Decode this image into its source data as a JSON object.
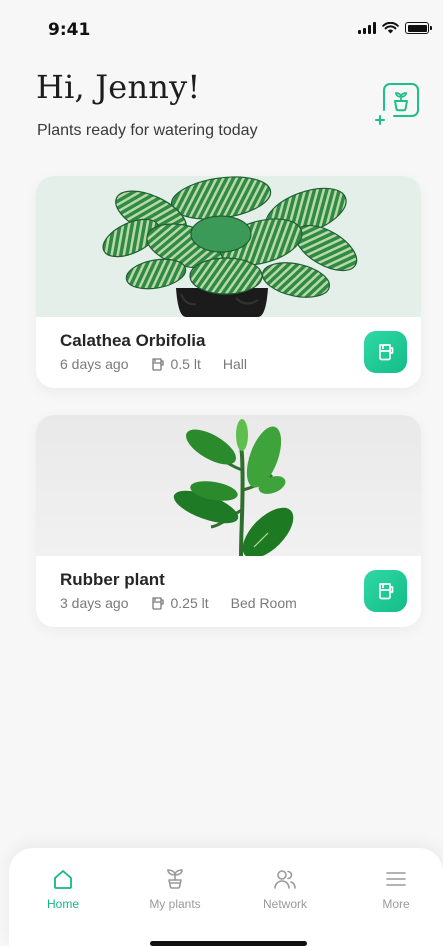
{
  "status_bar": {
    "time": "9:41",
    "icons": [
      "signal-icon",
      "wifi-icon",
      "battery-icon"
    ]
  },
  "header": {
    "greeting": "Hi, Jenny!",
    "subtitle": "Plants ready for watering today",
    "add_plant_icon": "add-plant-icon"
  },
  "plants": [
    {
      "name": "Calathea Orbifolia",
      "last_watered": "6 days ago",
      "water_amount": "0.5 lt",
      "location": "Hall",
      "image_icon": "calathea-plant-image"
    },
    {
      "name": "Rubber plant",
      "last_watered": "3 days ago",
      "water_amount": "0.25 lt",
      "location": "Bed Room",
      "image_icon": "rubber-plant-image"
    }
  ],
  "nav": {
    "items": [
      {
        "label": "Home",
        "icon": "home-icon",
        "active": true
      },
      {
        "label": "My plants",
        "icon": "plant-icon",
        "active": false
      },
      {
        "label": "Network",
        "icon": "users-icon",
        "active": false
      },
      {
        "label": "More",
        "icon": "menu-icon",
        "active": false
      }
    ]
  },
  "colors": {
    "accent": "#12b784",
    "button_gradient_start": "#2fd8a6",
    "button_gradient_end": "#14bd86",
    "background": "#f7f7f7",
    "muted_text": "#7a7a7a"
  }
}
